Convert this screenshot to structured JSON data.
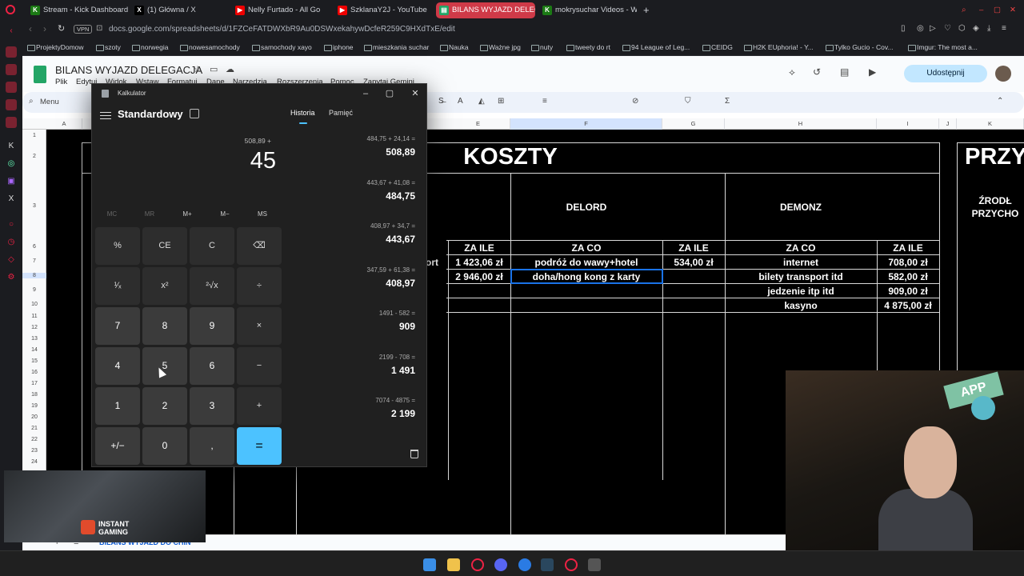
{
  "browser": {
    "tabs": [
      {
        "label": "Stream - Kick Dashboard",
        "icon": "kick-icon",
        "color": "#53fc18"
      },
      {
        "label": "(1) Główna / X",
        "icon": "x-icon",
        "color": "#ffffff"
      },
      {
        "label": "Nelly Furtado - All Go",
        "icon": "youtube-icon",
        "color": "#ff0000"
      },
      {
        "label": "SzklanaY2J - YouTube",
        "icon": "youtube-icon",
        "color": "#ff0000"
      },
      {
        "label": "BILANS WYJAZD DELEGA",
        "icon": "sheets-icon",
        "color": "#23a566"
      },
      {
        "label": "mokrysuchar Videos - W",
        "icon": "kick-icon",
        "color": "#53fc18"
      }
    ],
    "vpn_label": "VPN",
    "url": "docs.google.com/spreadsheets/d/1FZCeFATDWXbR9Au0DSWxekahywDcfeR259C9HXdTxE/edit",
    "bookmarks": [
      "ProjektyDomow",
      "szoty",
      "norwegia",
      "nowesamochody",
      "samochody xayo",
      "iphone",
      "mieszkania suchar",
      "Nauka",
      "Ważne jpg",
      "nuty",
      "tweety do rt",
      "94 League of Leg...",
      "CEIDG",
      "H2K EUphoria! - Y...",
      "Tylko Gucio - Cov...",
      "Imgur: The most a..."
    ]
  },
  "sheets": {
    "title": "BILANS WYJAZD DELEGACJA",
    "menus": [
      "Plik",
      "Edytuj",
      "Widok",
      "Wstaw",
      "Formatuj",
      "Dane",
      "Narzędzia",
      "Rozszerzenia",
      "Pomoc",
      "Zapytaj Gemini"
    ],
    "share_label": "Udostępnij",
    "menu_search": "Menu",
    "columns": [
      "A",
      "B",
      "C",
      "D",
      "E",
      "F",
      "G",
      "H",
      "I",
      "J",
      "K"
    ],
    "rows": [
      "1",
      "2",
      "3",
      "4",
      "5",
      "6",
      "7",
      "8",
      "9",
      "10",
      "11",
      "12",
      "13",
      "14",
      "15",
      "16",
      "17",
      "18",
      "19",
      "20",
      "21",
      "22",
      "23",
      "24"
    ],
    "koszty": "KOSZTY",
    "przy": "PRZY",
    "zrodla": "ŹRODŁ",
    "przychody": "PRZYCHO",
    "delord": "DELORD",
    "demonz": "DEMONZ",
    "za_ile": "ZA ILE",
    "za_co": "ZA CO",
    "partial_ort": "ort",
    "e_col": [
      "1 423,06 zł",
      "2 946,00 zł"
    ],
    "delord_items": [
      {
        "co": "podróż do wawy+hotel",
        "ile": "534,00 zł"
      },
      {
        "co": "doha/hong kong z karty",
        "ile": ""
      }
    ],
    "demonz_items": [
      {
        "co": "internet",
        "ile": "708,00 zł"
      },
      {
        "co": "bilety transport itd",
        "ile": "582,00 zł"
      },
      {
        "co": "jedzenie itp itd",
        "ile": "909,00 zł"
      },
      {
        "co": "kasyno",
        "ile": "4 875,00 zł"
      }
    ],
    "sheet_tab": "BILANS WYJAZD DO CHIN"
  },
  "calculator": {
    "window_title": "Kalkulator",
    "mode": "Standardowy",
    "tab_history": "Historia",
    "tab_memory": "Pamięć",
    "expression": "508,89 +",
    "display": "45",
    "memory_keys": [
      "MC",
      "MR",
      "M+",
      "M−",
      "MS"
    ],
    "keys": [
      [
        "%",
        "CE",
        "C",
        "⌫"
      ],
      [
        "¹⁄ₓ",
        "x²",
        "²√x",
        "÷"
      ],
      [
        "7",
        "8",
        "9",
        "×"
      ],
      [
        "4",
        "5",
        "6",
        "−"
      ],
      [
        "1",
        "2",
        "3",
        "+"
      ],
      [
        "+/−",
        "0",
        ",",
        "="
      ]
    ],
    "history": [
      {
        "expr": "484,75  +  24,14 =",
        "result": "508,89"
      },
      {
        "expr": "443,67  +  41,08 =",
        "result": "484,75"
      },
      {
        "expr": "408,97  +  34,7 =",
        "result": "443,67"
      },
      {
        "expr": "347,59  +  61,38 =",
        "result": "408,97"
      },
      {
        "expr": "1491  -  582 =",
        "result": "909"
      },
      {
        "expr": "2199  -  708 =",
        "result": "1 491"
      },
      {
        "expr": "7074  -  4875 =",
        "result": "2 199"
      }
    ]
  },
  "overlay": {
    "game_logo": "INSTANT GAMING",
    "banner": "APP"
  }
}
